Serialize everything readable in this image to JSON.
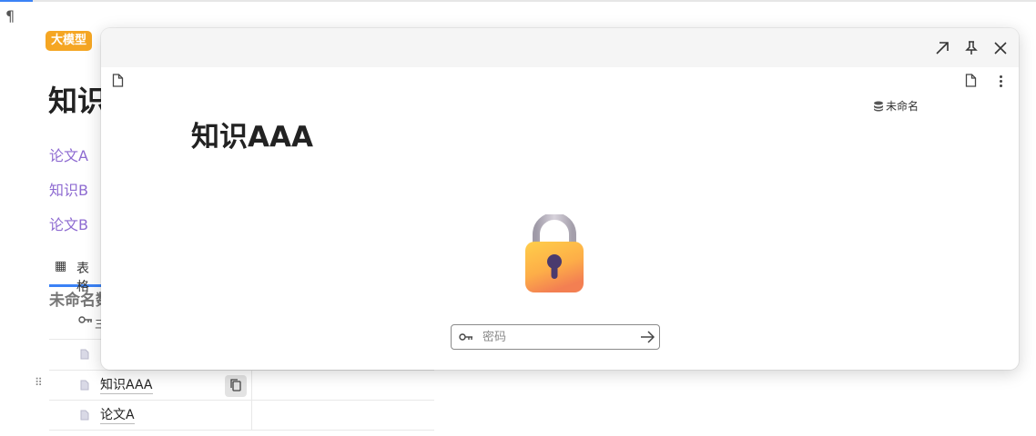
{
  "background": {
    "pilcrow": "¶",
    "badge": "大模型",
    "title": "知识",
    "links": [
      "论文A",
      "知识B",
      "论文B"
    ],
    "tab": {
      "icon": "table-grid-icon",
      "label": "表格"
    },
    "database_name": "未命名数",
    "table": {
      "header_icon": "key-icon",
      "header_label": "三",
      "rows": [
        {
          "icon": "document-icon",
          "title": ""
        },
        {
          "icon": "document-icon",
          "title": "知识AAA"
        },
        {
          "icon": "document-icon",
          "title": "论文A"
        }
      ]
    }
  },
  "popup": {
    "header_actions": [
      "open-in-full-icon",
      "pin-icon",
      "close-icon"
    ],
    "database_tag": "未命名",
    "title": "知识AAA",
    "password": {
      "placeholder": "密码",
      "value": ""
    }
  },
  "colors": {
    "accent_blue": "#3b82f6",
    "badge_orange": "#f5a623",
    "link_purple": "#8e6bd1"
  }
}
